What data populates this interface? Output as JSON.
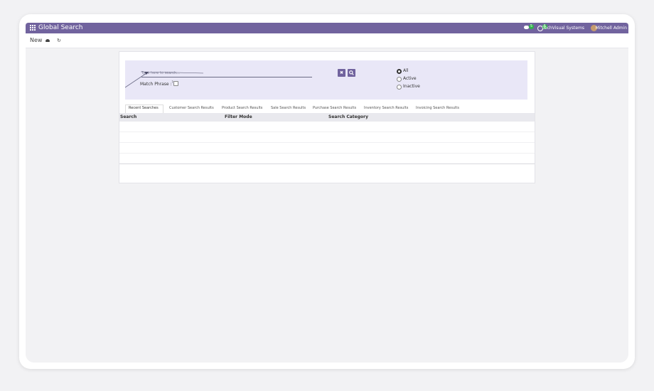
{
  "navbar": {
    "app_title": "Global Search",
    "chat_badge": "5",
    "activity_badge": "5",
    "company": "TechVisual Systems",
    "user": "Mitchell Admin"
  },
  "controlbar": {
    "new_label": "New"
  },
  "search": {
    "placeholder": "Type here to search...",
    "match_phrase_label": "Match Phrase :",
    "match_phrase_sup": "?"
  },
  "filter": {
    "options": [
      "All",
      "Active",
      "Inactive"
    ],
    "selected": "All"
  },
  "tabs": [
    "Recent Searches",
    "Customer Search Results",
    "Product Search Results",
    "Sale Search Results",
    "Purchase Search Results",
    "Inventory Search Results",
    "Invoicing Search Results"
  ],
  "table": {
    "columns": [
      "Search",
      "Filter Mode",
      "Search Category"
    ]
  },
  "colors": {
    "brand": "#71639e",
    "panel": "#e9e7f7",
    "badge": "#2fb34a"
  }
}
